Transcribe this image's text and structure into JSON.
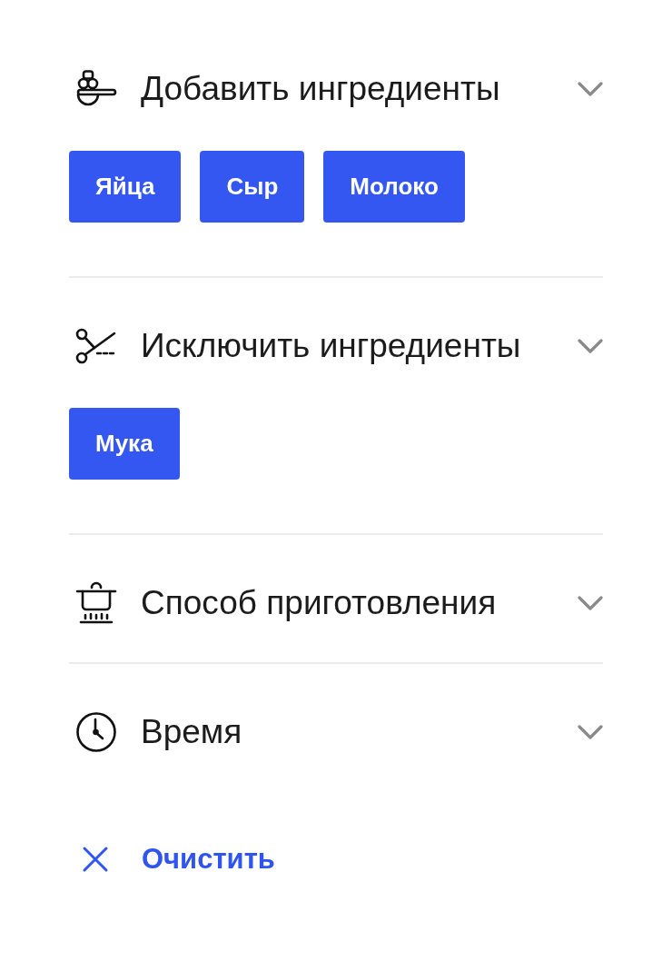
{
  "sections": [
    {
      "kind": "add",
      "title": "Добавить ингредиенты",
      "chips": [
        "Яйца",
        "Сыр",
        "Молоко"
      ]
    },
    {
      "kind": "exclude",
      "title": "Исключить ингредиенты",
      "chips": [
        "Мука"
      ]
    },
    {
      "kind": "cooking",
      "title": "Способ приготовления"
    },
    {
      "kind": "time",
      "title": "Время"
    }
  ],
  "clear_button": {
    "label": "Очистить"
  }
}
